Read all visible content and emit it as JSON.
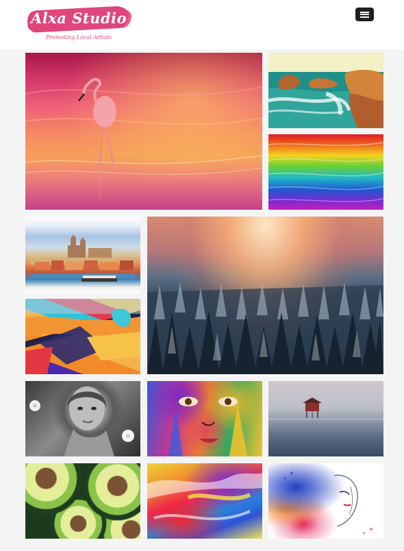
{
  "header": {
    "logo_title": "Alxa Studio",
    "logo_tagline": "Promoting Local Artists"
  },
  "colors": {
    "brand_pink": "#e0457b",
    "menu_button_bg": "#1f1f1f",
    "page_background": "#f4f4f4"
  },
  "icons": {
    "menu": "hamburger-menu-icon"
  },
  "gallery": [
    {
      "subject": "flamingo"
    },
    {
      "subject": "coastal cliffs"
    },
    {
      "subject": "rainbow stripes"
    },
    {
      "subject": "city skyline"
    },
    {
      "subject": "misty forest sunrise"
    },
    {
      "subject": "graffiti wall"
    },
    {
      "subject": "black and white portrait"
    },
    {
      "subject": "painted face"
    },
    {
      "subject": "stilt hut in fog"
    },
    {
      "subject": "avocados"
    },
    {
      "subject": "abstract paint"
    },
    {
      "subject": "watercolor woman"
    }
  ]
}
